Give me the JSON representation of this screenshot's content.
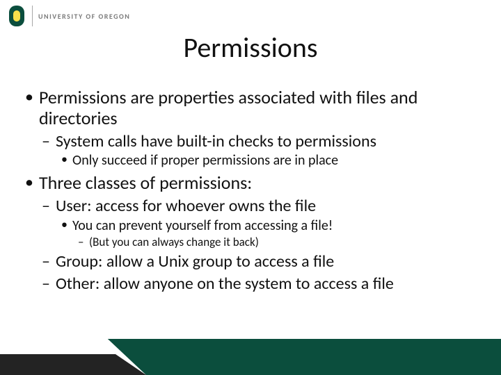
{
  "header": {
    "university": "UNIVERSITY OF OREGON"
  },
  "title": "Permissions",
  "bullets": {
    "b1": "Permissions are properties associated with files and directories",
    "b1a": "System calls have built-in checks to permissions",
    "b1a1": "Only succeed if proper permissions are in place",
    "b2": "Three classes of permissions:",
    "b2a": "User: access for whoever owns the file",
    "b2a1": "You can prevent yourself from accessing a file!",
    "b2a1a": "(But you can always change it back)",
    "b2b": "Group: allow a Unix group to access a file",
    "b2c": "Other: allow anyone on the system to access a file"
  }
}
